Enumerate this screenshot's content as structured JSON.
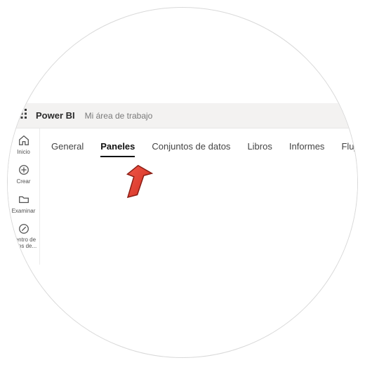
{
  "header": {
    "brand": "Power BI",
    "breadcrumb": "Mi área de trabajo"
  },
  "sidebar": {
    "items": [
      {
        "label": "Inicio",
        "icon": "home-icon"
      },
      {
        "label": "Crear",
        "icon": "plus-circle-icon"
      },
      {
        "label": "Examinar",
        "icon": "folder-icon"
      },
      {
        "label": "Centro de datos de...",
        "icon": "compass-icon"
      }
    ]
  },
  "tabs": {
    "items": [
      {
        "label": "General",
        "active": false
      },
      {
        "label": "Paneles",
        "active": true
      },
      {
        "label": "Conjuntos de datos",
        "active": false
      },
      {
        "label": "Libros",
        "active": false
      },
      {
        "label": "Informes",
        "active": false
      },
      {
        "label": "Flujos de datos",
        "active": false
      }
    ]
  },
  "annotation": {
    "arrow_color": "#e53528",
    "arrow_stroke": "#8f1f17"
  }
}
